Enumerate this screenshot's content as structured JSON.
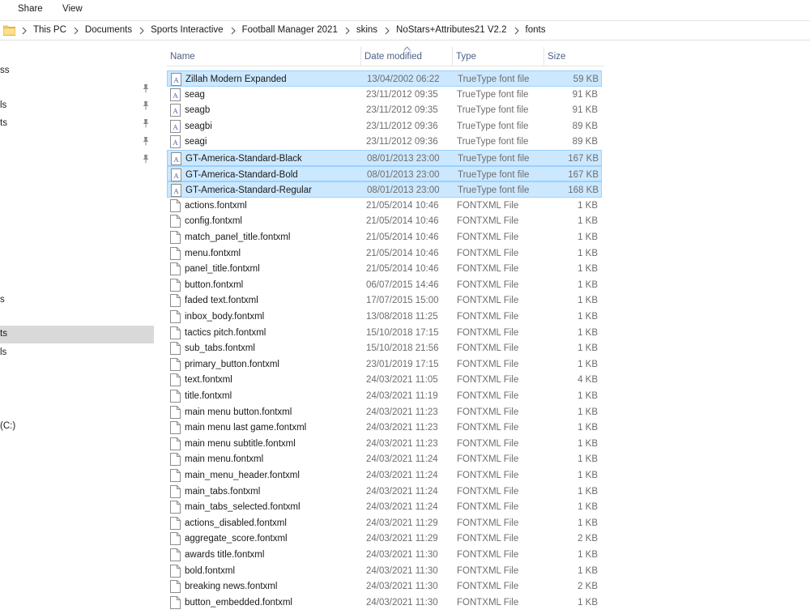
{
  "ribbon": {
    "tabs": [
      "Share",
      "View"
    ]
  },
  "address": {
    "crumbs": [
      "This PC",
      "Documents",
      "Sports Interactive",
      "Football Manager 2021",
      "skins",
      "NoStars+Attributes21 V2.2",
      "fonts"
    ]
  },
  "nav": {
    "items": [
      {
        "label": "ss",
        "pinned": false,
        "selected": false
      },
      {
        "label": "ls",
        "pinned": true,
        "selected": false
      },
      {
        "label": "ts",
        "pinned": true,
        "selected": false
      },
      {
        "label": "s",
        "pinned": false,
        "selected": false
      },
      {
        "label": "ts",
        "pinned": false,
        "selected": true
      },
      {
        "label": "ls",
        "pinned": false,
        "selected": false
      },
      {
        "label": "(C:)",
        "pinned": false,
        "selected": false
      }
    ],
    "extra_pins": 3
  },
  "columns": {
    "name": "Name",
    "date": "Date modified",
    "type": "Type",
    "size": "Size"
  },
  "files": [
    {
      "name": "Zillah Modern Expanded",
      "date": "13/04/2002 06:22",
      "type": "TrueType font file",
      "size": "59 KB",
      "kind": "font",
      "selected": true
    },
    {
      "name": "seag",
      "date": "23/11/2012 09:35",
      "type": "TrueType font file",
      "size": "91 KB",
      "kind": "font",
      "selected": false
    },
    {
      "name": "seagb",
      "date": "23/11/2012 09:35",
      "type": "TrueType font file",
      "size": "91 KB",
      "kind": "font",
      "selected": false
    },
    {
      "name": "seagbi",
      "date": "23/11/2012 09:36",
      "type": "TrueType font file",
      "size": "89 KB",
      "kind": "font",
      "selected": false
    },
    {
      "name": "seagi",
      "date": "23/11/2012 09:36",
      "type": "TrueType font file",
      "size": "89 KB",
      "kind": "font",
      "selected": false
    },
    {
      "name": "GT-America-Standard-Black",
      "date": "08/01/2013 23:00",
      "type": "TrueType font file",
      "size": "167 KB",
      "kind": "font",
      "selected": true
    },
    {
      "name": "GT-America-Standard-Bold",
      "date": "08/01/2013 23:00",
      "type": "TrueType font file",
      "size": "167 KB",
      "kind": "font",
      "selected": true
    },
    {
      "name": "GT-America-Standard-Regular",
      "date": "08/01/2013 23:00",
      "type": "TrueType font file",
      "size": "168 KB",
      "kind": "font",
      "selected": true
    },
    {
      "name": "actions.fontxml",
      "date": "21/05/2014 10:46",
      "type": "FONTXML File",
      "size": "1 KB",
      "kind": "file",
      "selected": false
    },
    {
      "name": "config.fontxml",
      "date": "21/05/2014 10:46",
      "type": "FONTXML File",
      "size": "1 KB",
      "kind": "file",
      "selected": false
    },
    {
      "name": "match_panel_title.fontxml",
      "date": "21/05/2014 10:46",
      "type": "FONTXML File",
      "size": "1 KB",
      "kind": "file",
      "selected": false
    },
    {
      "name": "menu.fontxml",
      "date": "21/05/2014 10:46",
      "type": "FONTXML File",
      "size": "1 KB",
      "kind": "file",
      "selected": false
    },
    {
      "name": "panel_title.fontxml",
      "date": "21/05/2014 10:46",
      "type": "FONTXML File",
      "size": "1 KB",
      "kind": "file",
      "selected": false
    },
    {
      "name": "button.fontxml",
      "date": "06/07/2015 14:46",
      "type": "FONTXML File",
      "size": "1 KB",
      "kind": "file",
      "selected": false
    },
    {
      "name": "faded text.fontxml",
      "date": "17/07/2015 15:00",
      "type": "FONTXML File",
      "size": "1 KB",
      "kind": "file",
      "selected": false
    },
    {
      "name": "inbox_body.fontxml",
      "date": "13/08/2018 11:25",
      "type": "FONTXML File",
      "size": "1 KB",
      "kind": "file",
      "selected": false
    },
    {
      "name": "tactics pitch.fontxml",
      "date": "15/10/2018 17:15",
      "type": "FONTXML File",
      "size": "1 KB",
      "kind": "file",
      "selected": false
    },
    {
      "name": "sub_tabs.fontxml",
      "date": "15/10/2018 21:56",
      "type": "FONTXML File",
      "size": "1 KB",
      "kind": "file",
      "selected": false
    },
    {
      "name": "primary_button.fontxml",
      "date": "23/01/2019 17:15",
      "type": "FONTXML File",
      "size": "1 KB",
      "kind": "file",
      "selected": false
    },
    {
      "name": "text.fontxml",
      "date": "24/03/2021 11:05",
      "type": "FONTXML File",
      "size": "4 KB",
      "kind": "file",
      "selected": false
    },
    {
      "name": "title.fontxml",
      "date": "24/03/2021 11:19",
      "type": "FONTXML File",
      "size": "1 KB",
      "kind": "file",
      "selected": false
    },
    {
      "name": "main menu button.fontxml",
      "date": "24/03/2021 11:23",
      "type": "FONTXML File",
      "size": "1 KB",
      "kind": "file",
      "selected": false
    },
    {
      "name": "main menu last game.fontxml",
      "date": "24/03/2021 11:23",
      "type": "FONTXML File",
      "size": "1 KB",
      "kind": "file",
      "selected": false
    },
    {
      "name": "main menu subtitle.fontxml",
      "date": "24/03/2021 11:23",
      "type": "FONTXML File",
      "size": "1 KB",
      "kind": "file",
      "selected": false
    },
    {
      "name": "main menu.fontxml",
      "date": "24/03/2021 11:24",
      "type": "FONTXML File",
      "size": "1 KB",
      "kind": "file",
      "selected": false
    },
    {
      "name": "main_menu_header.fontxml",
      "date": "24/03/2021 11:24",
      "type": "FONTXML File",
      "size": "1 KB",
      "kind": "file",
      "selected": false
    },
    {
      "name": "main_tabs.fontxml",
      "date": "24/03/2021 11:24",
      "type": "FONTXML File",
      "size": "1 KB",
      "kind": "file",
      "selected": false
    },
    {
      "name": "main_tabs_selected.fontxml",
      "date": "24/03/2021 11:24",
      "type": "FONTXML File",
      "size": "1 KB",
      "kind": "file",
      "selected": false
    },
    {
      "name": "actions_disabled.fontxml",
      "date": "24/03/2021 11:29",
      "type": "FONTXML File",
      "size": "1 KB",
      "kind": "file",
      "selected": false
    },
    {
      "name": "aggregate_score.fontxml",
      "date": "24/03/2021 11:29",
      "type": "FONTXML File",
      "size": "2 KB",
      "kind": "file",
      "selected": false
    },
    {
      "name": "awards title.fontxml",
      "date": "24/03/2021 11:30",
      "type": "FONTXML File",
      "size": "1 KB",
      "kind": "file",
      "selected": false
    },
    {
      "name": "bold.fontxml",
      "date": "24/03/2021 11:30",
      "type": "FONTXML File",
      "size": "1 KB",
      "kind": "file",
      "selected": false
    },
    {
      "name": "breaking news.fontxml",
      "date": "24/03/2021 11:30",
      "type": "FONTXML File",
      "size": "2 KB",
      "kind": "file",
      "selected": false
    },
    {
      "name": "button_embedded.fontxml",
      "date": "24/03/2021 11:30",
      "type": "FONTXML File",
      "size": "1 KB",
      "kind": "file",
      "selected": false
    }
  ]
}
